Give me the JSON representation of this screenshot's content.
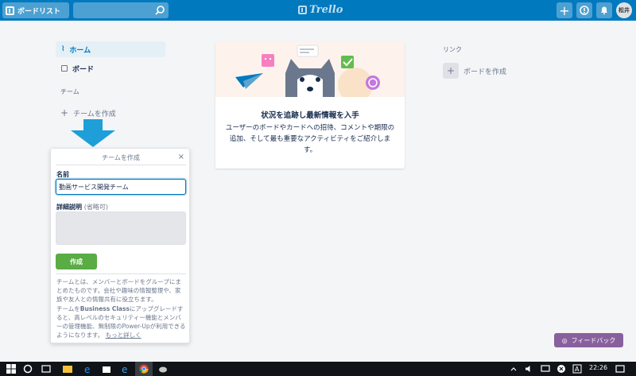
{
  "header": {
    "boards_label": "ボードリスト",
    "logo_text": "Trello",
    "avatar_text": "松井"
  },
  "sidebar": {
    "home_label": "ホーム",
    "boards_label": "ボード",
    "teams_heading": "チーム",
    "create_team_label": "チームを作成"
  },
  "popover": {
    "title": "チームを作成",
    "close": "×",
    "name_label": "名前",
    "name_value": "動画サービス開発チーム",
    "desc_label": "詳細説明",
    "desc_optional": "(省略可)",
    "create_button": "作成",
    "info_text": "チームとは、メンバーとボードをグループにまとめたものです。会社や趣味の情報整理や、家族や友人との情報共有に役立ちます。",
    "upgrade_text_prefix": "チームを",
    "upgrade_bold": "Business Class",
    "upgrade_text_suffix": "にアップグレードすると、高レベルのセキュリティー機能とメンバーの管理機能、無制限のPower-Upが利用できるようになります。",
    "learn_more": "もっと詳しく"
  },
  "card": {
    "title": "状況を追跡し最新情報を入手",
    "description": "ユーザーのボードやカードへの招待、コメントや期限の追加、そして最も重要なアクティビティをご紹介します。"
  },
  "links": {
    "heading": "リンク",
    "create_board_label": "ボードを作成"
  },
  "feedback": {
    "label": "フィードバック"
  },
  "taskbar": {
    "time": "22:26"
  },
  "colors": {
    "header": "#0079bf",
    "create_button": "#5aac44",
    "feedback": "#89609e",
    "arrow": "#1e9fd8"
  }
}
